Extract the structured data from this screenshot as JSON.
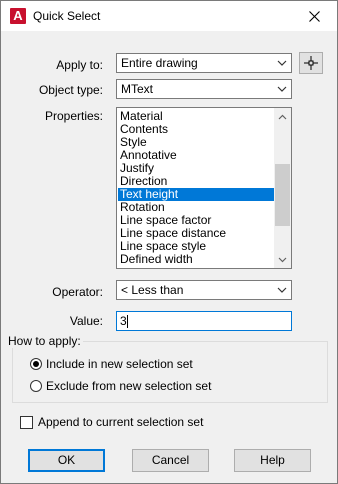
{
  "window": {
    "title": "Quick Select",
    "app_icon": "A"
  },
  "apply_to": {
    "label": "Apply to:",
    "value": "Entire drawing"
  },
  "object_type": {
    "label": "Object type:",
    "value": "MText"
  },
  "properties": {
    "label": "Properties:",
    "items": [
      "Material",
      "Contents",
      "Style",
      "Annotative",
      "Justify",
      "Direction",
      "Text height",
      "Rotation",
      "Line space factor",
      "Line space distance",
      "Line space style",
      "Defined width"
    ],
    "selected": "Text height"
  },
  "operator": {
    "label": "Operator:",
    "value": "< Less than"
  },
  "value": {
    "label": "Value:",
    "text": "3"
  },
  "how_to_apply": {
    "title": "How to apply:",
    "include_label": "Include in new selection set",
    "exclude_label": "Exclude from new selection set",
    "selected": "include"
  },
  "append": {
    "label": "Append to current selection set",
    "checked": false
  },
  "buttons": {
    "ok": "OK",
    "cancel": "Cancel",
    "help": "Help"
  },
  "colors": {
    "selection": "#0078d7",
    "app_icon": "#c8102e"
  }
}
